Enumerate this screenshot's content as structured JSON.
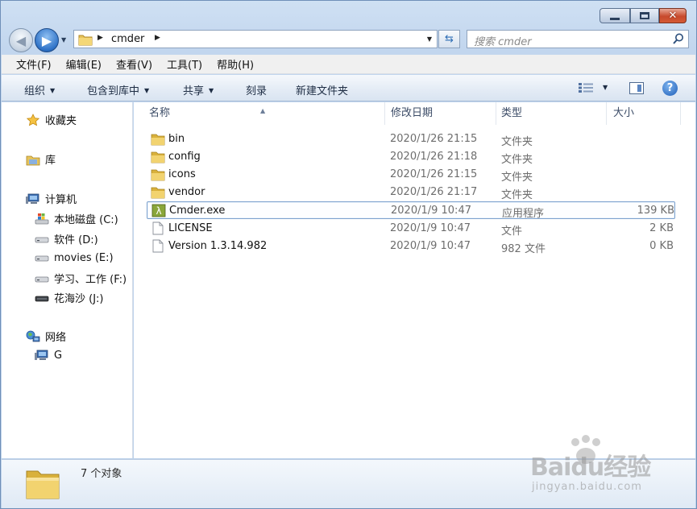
{
  "window": {
    "caption_buttons": {
      "minimize_icon": "minimize-icon",
      "maximize_icon": "maximize-icon",
      "close_glyph": "✕"
    }
  },
  "nav": {
    "back_glyph": "◀",
    "forward_glyph": "▶",
    "breadcrumb": "cmder",
    "search_placeholder": "搜索 cmder"
  },
  "menu": {
    "items": [
      "文件(F)",
      "编辑(E)",
      "查看(V)",
      "工具(T)",
      "帮助(H)"
    ]
  },
  "toolbar": {
    "organize": "组织",
    "include_in_library": "包含到库中",
    "share": "共享",
    "burn": "刻录",
    "new_folder": "新建文件夹",
    "help_glyph": "?"
  },
  "sidebar": {
    "favorites": "收藏夹",
    "libraries": "库",
    "computer": "计算机",
    "drives": [
      "本地磁盘 (C:)",
      "软件 (D:)",
      "movies (E:)",
      "学习、工作 (F:)",
      "花海沙 (J:)"
    ],
    "network": "网络",
    "network_items": [
      "G"
    ]
  },
  "columns": {
    "name": "名称",
    "modified": "修改日期",
    "type": "类型",
    "size": "大小"
  },
  "files": [
    {
      "name": "bin",
      "modified": "2020/1/26 21:15",
      "type": "文件夹",
      "size": "",
      "icon": "folder-icon"
    },
    {
      "name": "config",
      "modified": "2020/1/26 21:18",
      "type": "文件夹",
      "size": "",
      "icon": "folder-icon"
    },
    {
      "name": "icons",
      "modified": "2020/1/26 21:15",
      "type": "文件夹",
      "size": "",
      "icon": "folder-icon"
    },
    {
      "name": "vendor",
      "modified": "2020/1/26 21:17",
      "type": "文件夹",
      "size": "",
      "icon": "folder-icon"
    },
    {
      "name": "Cmder.exe",
      "modified": "2020/1/9 10:47",
      "type": "应用程序",
      "size": "139 KB",
      "icon": "lambda-app-icon",
      "selected": true
    },
    {
      "name": "LICENSE",
      "modified": "2020/1/9 10:47",
      "type": "文件",
      "size": "2 KB",
      "icon": "file-icon"
    },
    {
      "name": "Version 1.3.14.982",
      "modified": "2020/1/9 10:47",
      "type": "982 文件",
      "size": "0 KB",
      "icon": "file-icon"
    }
  ],
  "details": {
    "summary": "7 个对象"
  },
  "watermark": {
    "logo": "Baidu经验",
    "url": "jingyan.baidu.com"
  }
}
